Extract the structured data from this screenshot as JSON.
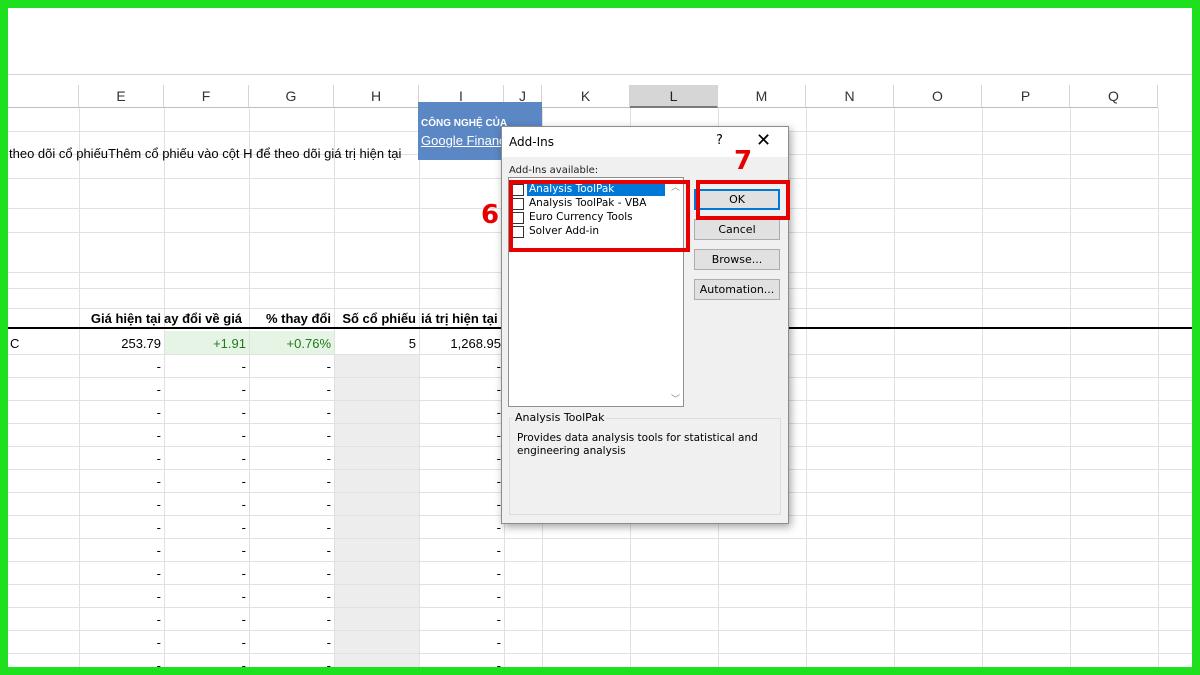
{
  "columns": [
    "E",
    "F",
    "G",
    "H",
    "I",
    "J",
    "K",
    "L",
    "M",
    "N",
    "O",
    "P",
    "Q"
  ],
  "banner": {
    "line1": "CÔNG NGHỆ CỦA",
    "line2": "Google Finance"
  },
  "instruction_text": "theo dõi cổ phiếuThêm cổ phiếu vào cột H để theo dõi giá trị hiện tại",
  "table": {
    "headers": [
      "Giá hiện tại",
      "ay đổi về giá",
      "% thay đổi",
      "Số cổ phiếu",
      "iá trị hiện tại"
    ],
    "first_row": {
      "label": "C",
      "price": "253.79",
      "change": "+1.91",
      "pct": "+0.76%",
      "shares": "5",
      "value": "1,268.95"
    },
    "empty_value": "-"
  },
  "dialog": {
    "title": "Add-Ins",
    "help": "?",
    "close": "✕",
    "available_label": "Add-Ins available:",
    "items": [
      {
        "label": "Analysis ToolPak",
        "checked": false,
        "selected": true
      },
      {
        "label": "Analysis ToolPak - VBA",
        "checked": false,
        "selected": false
      },
      {
        "label": "Euro Currency Tools",
        "checked": false,
        "selected": false
      },
      {
        "label": "Solver Add-in",
        "checked": false,
        "selected": false
      }
    ],
    "buttons": {
      "ok": "OK",
      "cancel": "Cancel",
      "browse": "Browse...",
      "automation": "Automation..."
    },
    "desc_title": "Analysis ToolPak",
    "desc_text": "Provides data analysis tools for statistical and engineering analysis"
  },
  "annotations": {
    "step6": "6",
    "step7": "7"
  },
  "colors": {
    "frame": "#1fe01f",
    "highlight": "#e60000",
    "banner": "#5b87c5",
    "positive": "#1e7b1e"
  }
}
